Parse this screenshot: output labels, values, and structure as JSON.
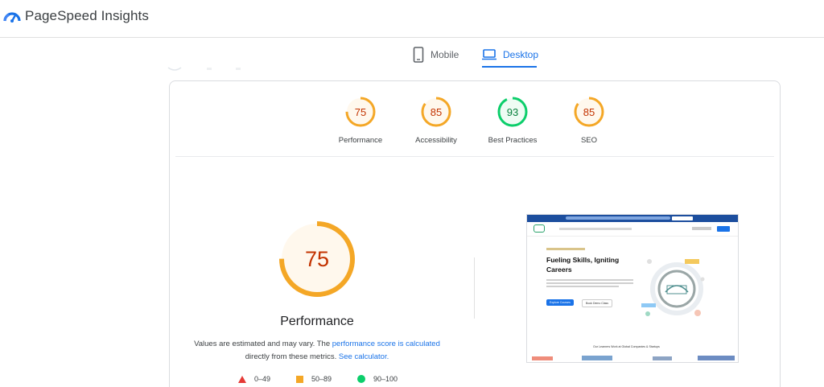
{
  "header": {
    "brand": "PageSpeed Insights"
  },
  "tabs": [
    {
      "label": "Mobile",
      "icon": "phone-icon",
      "active": false
    },
    {
      "label": "Desktop",
      "icon": "laptop-icon",
      "active": true
    }
  ],
  "scores": [
    {
      "label": "Performance",
      "value": 75,
      "status": "average",
      "color": "#f4a726"
    },
    {
      "label": "Accessibility",
      "value": 85,
      "status": "average",
      "color": "#f4a726"
    },
    {
      "label": "Best Practices",
      "value": 93,
      "status": "good",
      "color": "#0cce6b"
    },
    {
      "label": "SEO",
      "value": 85,
      "status": "average",
      "color": "#f4a726"
    }
  ],
  "main_gauge": {
    "label": "Performance",
    "value": 75,
    "color": "#f4a726"
  },
  "description": {
    "before": "Values are estimated and may vary. The ",
    "link1": "performance score is calculated",
    "middle": " directly from these metrics. ",
    "link2": "See calculator."
  },
  "legend": [
    {
      "range": "0–49",
      "shape": "triangle",
      "color": "#e53935"
    },
    {
      "range": "50–89",
      "shape": "square",
      "color": "#f4a726"
    },
    {
      "range": "90–100",
      "shape": "circle",
      "color": "#0cce6b"
    }
  ],
  "preview": {
    "headline_line1": "Fueling Skills, Igniting",
    "headline_line2": "Careers",
    "button_primary": "Explore Courses",
    "button_secondary": "Book Demo Class",
    "footer_text": "Our Learners Work at Global Companies & Startups"
  },
  "colors": {
    "accent": "#1a73e8",
    "average": "#f4a726",
    "good": "#0cce6b",
    "poor": "#e53935"
  }
}
